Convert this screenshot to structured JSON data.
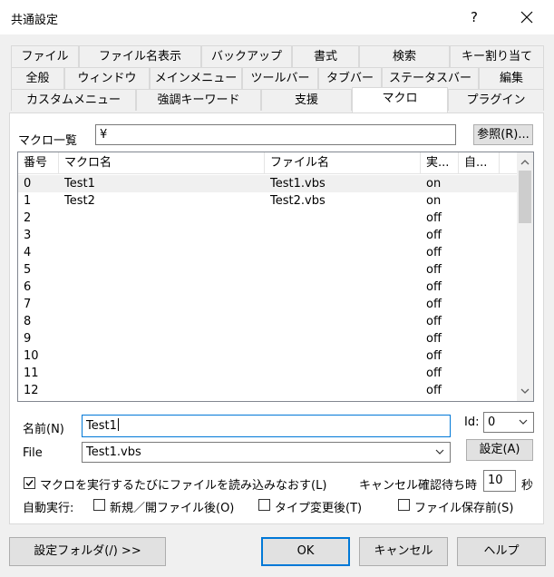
{
  "window": {
    "title": "共通設定",
    "help_glyph": "?"
  },
  "tabs_row1": [
    "ファイル",
    "ファイル名表示",
    "バックアップ",
    "書式",
    "検索",
    "キー割り当て"
  ],
  "tabs_row2": [
    "全般",
    "ウィンドウ",
    "メインメニュー",
    "ツールバー",
    "タブバー",
    "ステータスバー",
    "編集"
  ],
  "tabs_row3": [
    "カスタムメニュー",
    "強調キーワード",
    "支援",
    "マクロ",
    "プラグイン"
  ],
  "active_tab": "マクロ",
  "macro_list": {
    "label": "マクロ一覧",
    "path_value": "¥",
    "browse_label": "参照(R)..."
  },
  "table": {
    "headers": [
      "番号",
      "マクロ名",
      "ファイル名",
      "実...",
      "自..."
    ],
    "rows": [
      [
        "0",
        "Test1",
        "Test1.vbs",
        "on",
        ""
      ],
      [
        "1",
        "Test2",
        "Test2.vbs",
        "on",
        ""
      ],
      [
        "2",
        "",
        "",
        "off",
        ""
      ],
      [
        "3",
        "",
        "",
        "off",
        ""
      ],
      [
        "4",
        "",
        "",
        "off",
        ""
      ],
      [
        "5",
        "",
        "",
        "off",
        ""
      ],
      [
        "6",
        "",
        "",
        "off",
        ""
      ],
      [
        "7",
        "",
        "",
        "off",
        ""
      ],
      [
        "8",
        "",
        "",
        "off",
        ""
      ],
      [
        "9",
        "",
        "",
        "off",
        ""
      ],
      [
        "10",
        "",
        "",
        "off",
        ""
      ],
      [
        "11",
        "",
        "",
        "off",
        ""
      ],
      [
        "12",
        "",
        "",
        "off",
        ""
      ]
    ]
  },
  "form": {
    "name_label": "名前(N)",
    "name_value": "Test1",
    "id_label": "Id:",
    "id_value": "0",
    "file_label": "File",
    "file_value": "Test1.vbs",
    "set_label": "設定(A)"
  },
  "options": {
    "reload_label": "マクロを実行するたびにファイルを読み込みなおす(L)",
    "reload_checked": true,
    "cancel_wait_label": "キャンセル確認待ち時",
    "cancel_wait_value": "10",
    "seconds_label": "秒",
    "autorun_label": "自動実行:",
    "auto_new_open": "新規／開ファイル後(O)",
    "auto_type_change": "タイプ変更後(T)",
    "auto_before_save": "ファイル保存前(S)"
  },
  "footer": {
    "settings_folder": "設定フォルダ(/) >>",
    "ok": "OK",
    "cancel": "キャンセル",
    "help": "ヘルプ"
  }
}
